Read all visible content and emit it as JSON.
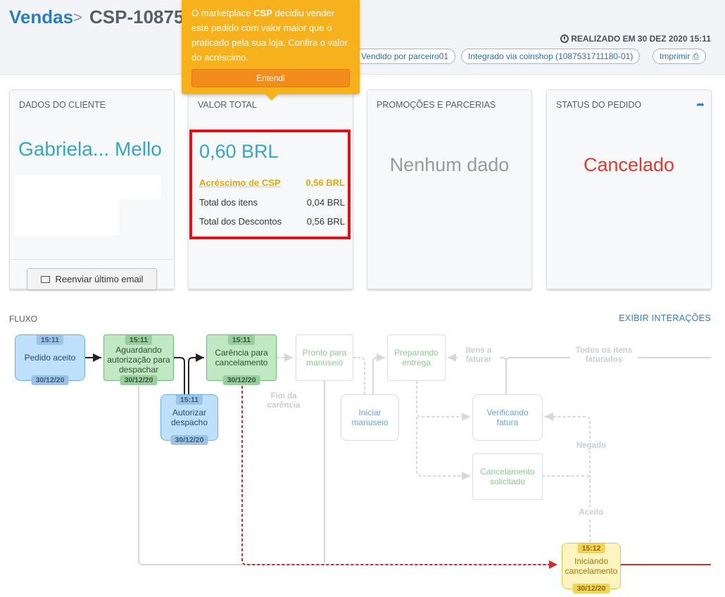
{
  "header": {
    "breadcrumb_root": "Vendas",
    "breadcrumb_sep": ">",
    "order_title": "CSP-10875                   30)",
    "realizado": "REALIZADO EM 30 DEZ 2020 15:11",
    "tags": [
      "Vendido por parceiro01",
      "Integrado via coinshop (1087531711180-01)",
      "Imprimir"
    ]
  },
  "tooltip": {
    "msg_before": "O marketplace ",
    "msg_bold": "CSP",
    "msg_after": " decidiu vender este pedido com valor maior que o praticado pela sua loja. Confira o valor do acréscimo.",
    "button": "Entendi"
  },
  "cards": {
    "client": {
      "title": "DADOS DO CLIENTE",
      "name": "Gabriela... Mello",
      "resend": "Reenviar último email"
    },
    "total": {
      "title": "VALOR TOTAL",
      "value": "0,60 BRL",
      "rows": [
        {
          "label": "Acréscimo de CSP",
          "value": "0,56 BRL"
        },
        {
          "label": "Total dos itens",
          "value": "0,04 BRL"
        },
        {
          "label": "Total dos Descontos",
          "value": "0,56 BRL"
        }
      ]
    },
    "promos": {
      "title": "PROMOÇÕES E PARCERIAS",
      "value": "Nenhum dado"
    },
    "status": {
      "title": "STATUS DO PEDIDO",
      "value": "Cancelado"
    }
  },
  "flow": {
    "title": "FLUXO",
    "link": "EXIBIR INTERAÇÕES",
    "nodes": {
      "pedido_aceito": {
        "label": "Pedido aceito",
        "time": "15:11",
        "date": "30/12/20"
      },
      "aguardando": {
        "label": "Aguardando autorização para despachar",
        "time": "15:11",
        "date": "30/12/20"
      },
      "autorizar": {
        "label": "Autorizar despacho",
        "time": "15:11",
        "date": "30/12/20"
      },
      "carencia": {
        "label": "Carência para cancelamento",
        "time": "15:11",
        "date": "30/12/20"
      },
      "pronto": {
        "label": "Pronto para manuseio"
      },
      "iniciar_manuseio": {
        "label": "Iniciar manuseio"
      },
      "preparando": {
        "label": "Preparando entrega"
      },
      "verificando": {
        "label": "Verificando fatura"
      },
      "cancelamento_solicitado": {
        "label": "Cancelamento solicitado"
      },
      "iniciando_cancelamento": {
        "label": "Iniciando cancelamento",
        "time": "15:12",
        "date": "30/12/20"
      }
    },
    "labels": {
      "fim_carencia": "Fim da carência",
      "itens_faturar": "Itens a faturar",
      "todos_faturados": "Todos os itens faturados",
      "negado": "Negado",
      "aceito": "Aceito"
    }
  }
}
